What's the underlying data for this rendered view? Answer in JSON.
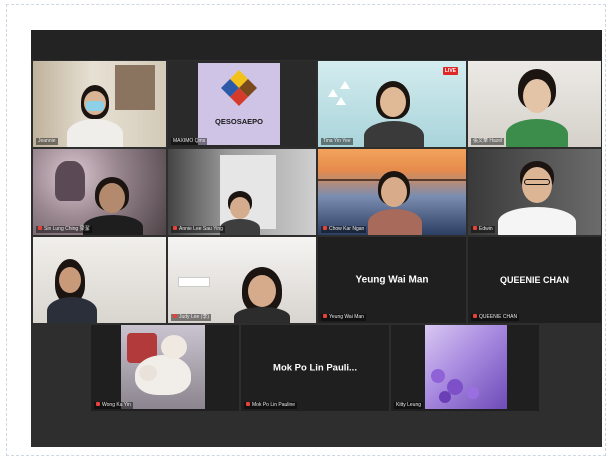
{
  "meeting": {
    "logo_text": "QESOSAEPO",
    "live_badge": "LIVE"
  },
  "participants": [
    {
      "id": "p1",
      "name": "Jeannie",
      "video": true
    },
    {
      "id": "p2",
      "name": "MAXIMO Qms",
      "video": true
    },
    {
      "id": "p3",
      "name": "Tina Yin Yee",
      "video": true
    },
    {
      "id": "p4",
      "name": "張文華 Hazel",
      "video": true
    },
    {
      "id": "p5",
      "name": "Sin Lung Ching 梁潔",
      "video": true
    },
    {
      "id": "p6",
      "name": "Annie Lee Sau Ying",
      "video": true
    },
    {
      "id": "p7",
      "name": "Chow Kar Ngan",
      "video": true
    },
    {
      "id": "p8",
      "name": "Edwin",
      "video": true
    },
    {
      "id": "p9",
      "name": "",
      "video": true
    },
    {
      "id": "p10",
      "name": "Judy Lee (李)",
      "video": true
    },
    {
      "id": "p11",
      "name": "Yeung Wai Man",
      "display": "Yeung Wai Man",
      "video": false
    },
    {
      "id": "p12",
      "name": "QUEENIE CHAN",
      "display": "QUEENIE CHAN",
      "video": false
    },
    {
      "id": "p13",
      "name": "Wong Ka Yin",
      "video": true
    },
    {
      "id": "p14",
      "name": "Mok Po Lin Pauline",
      "display": "Mok Po Lin Pauli...",
      "video": false
    },
    {
      "id": "p15",
      "name": "Kitty Leung",
      "video": true
    }
  ]
}
